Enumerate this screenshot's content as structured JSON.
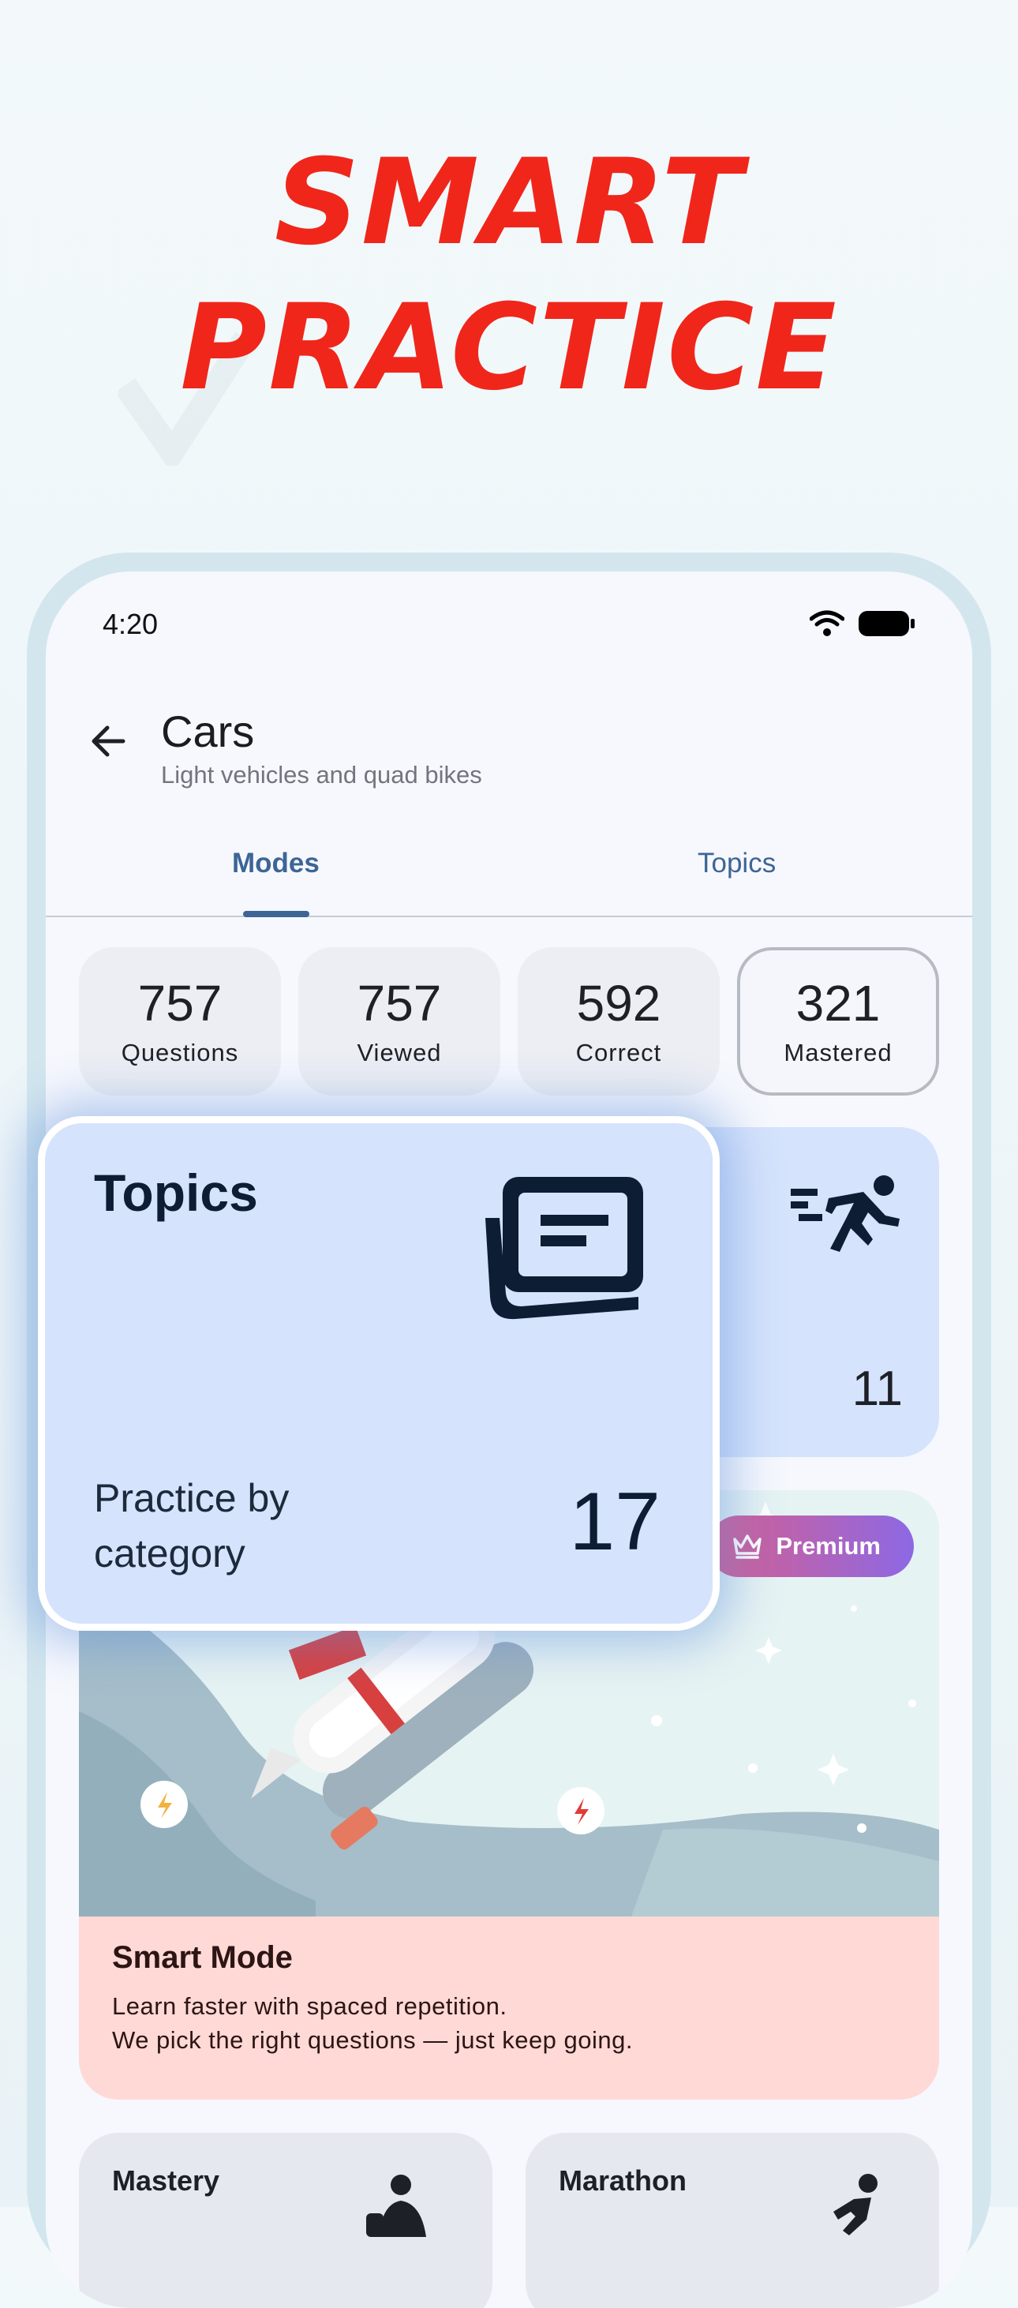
{
  "headline": {
    "line1": "SMART",
    "line2": "PRACTICE"
  },
  "status_bar": {
    "time": "4:20"
  },
  "header": {
    "title": "Cars",
    "subtitle": "Light vehicles and quad bikes"
  },
  "tabs": [
    {
      "label": "Modes",
      "selected": true
    },
    {
      "label": "Topics",
      "selected": false
    }
  ],
  "stats": [
    {
      "value": "757",
      "label": "Questions"
    },
    {
      "value": "757",
      "label": "Viewed"
    },
    {
      "value": "592",
      "label": "Correct"
    },
    {
      "value": "321",
      "label": "Mastered"
    }
  ],
  "quick_card": {
    "count": "11",
    "icon": "running-person-icon"
  },
  "smart_card": {
    "badge": "Premium",
    "title": "Smart Mode",
    "line1": "Learn faster with spaced repetition.",
    "line2": "We pick the right questions — just keep going."
  },
  "mini_cards": [
    {
      "title": "Mastery"
    },
    {
      "title": "Marathon"
    }
  ],
  "overlay_card": {
    "title": "Topics",
    "description": "Practice by category",
    "count": "17",
    "icon": "articles-icon"
  },
  "colors": {
    "headline": "#f0261b",
    "accent": "#3d6596",
    "card_blue": "#d5e3fc",
    "card_pink": "#ffd9d6"
  }
}
